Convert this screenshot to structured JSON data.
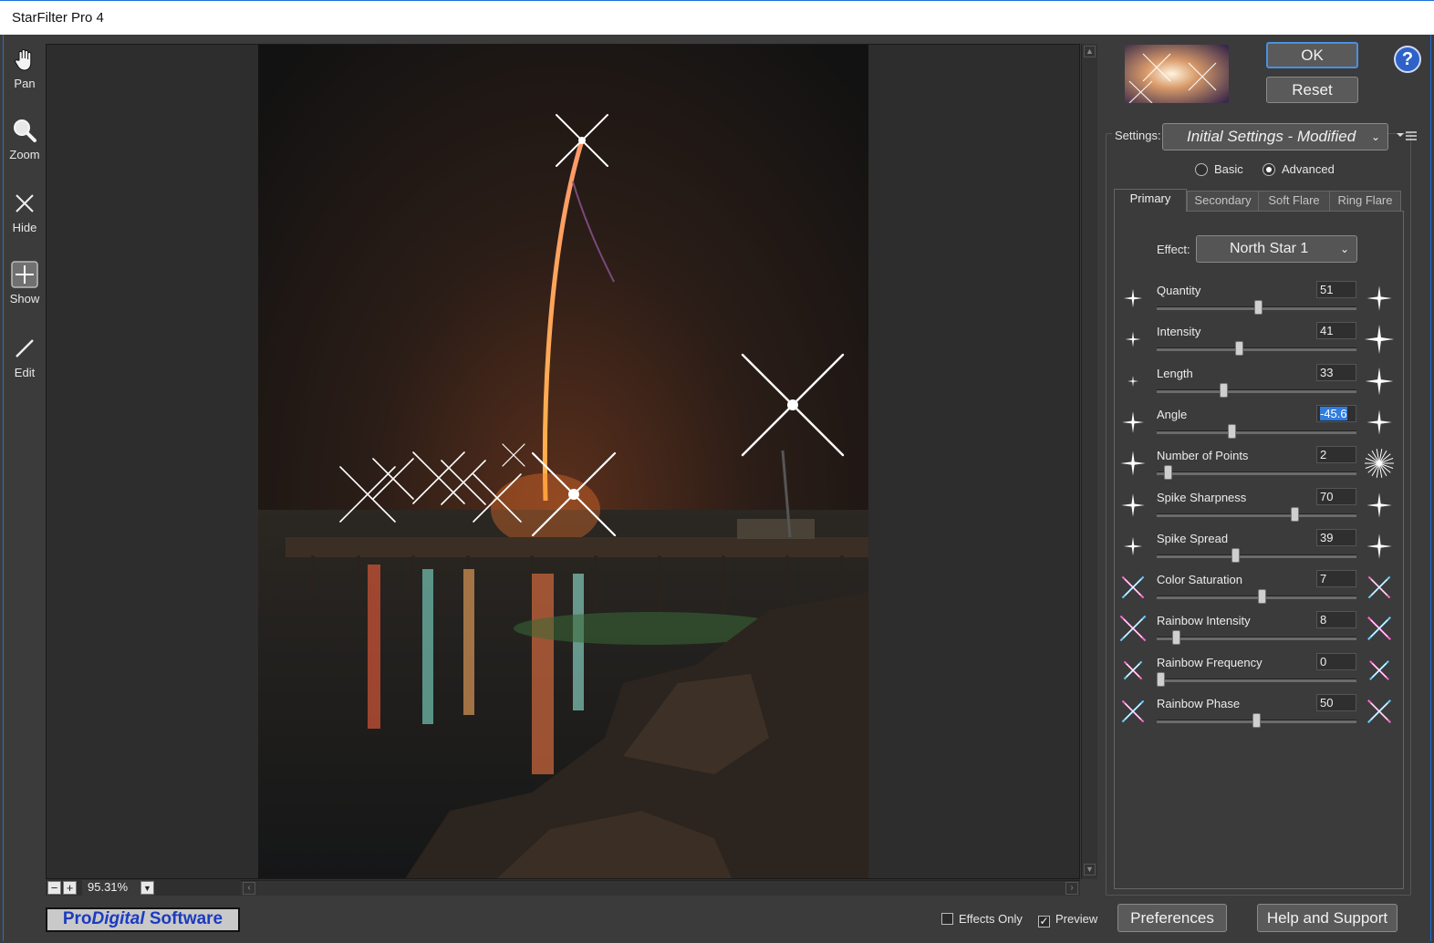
{
  "window": {
    "title": "StarFilter Pro 4"
  },
  "tools": [
    {
      "label": "Pan",
      "icon": "hand-icon"
    },
    {
      "label": "Zoom",
      "icon": "magnifier-icon"
    },
    {
      "label": "Hide",
      "icon": "x-icon"
    },
    {
      "label": "Show",
      "icon": "plus-box-icon"
    },
    {
      "label": "Edit",
      "icon": "pencil-icon"
    }
  ],
  "preview": {
    "zoom": "95.31%"
  },
  "logo": {
    "pro": "Pro",
    "digital": "Digital",
    "software": " Software"
  },
  "footer": {
    "effects_only": "Effects Only",
    "effects_only_checked": false,
    "preview_label": "Preview",
    "preview_checked": true,
    "preferences": "Preferences",
    "help_support": "Help and Support"
  },
  "buttons": {
    "ok": "OK",
    "reset": "Reset",
    "help": "?"
  },
  "settings": {
    "label": "Settings:",
    "value": "Initial Settings - Modified",
    "mode_basic": "Basic",
    "mode_advanced": "Advanced",
    "mode_selected": "Advanced"
  },
  "tabs": [
    {
      "label": "Primary",
      "active": true
    },
    {
      "label": "Secondary",
      "active": false
    },
    {
      "label": "Soft Flare",
      "active": false
    },
    {
      "label": "Ring Flare",
      "active": false
    }
  ],
  "effect": {
    "label": "Effect:",
    "value": "North Star 1"
  },
  "sliders": [
    {
      "name": "Quantity",
      "value": "51",
      "fraction": 0.51
    },
    {
      "name": "Intensity",
      "value": "41",
      "fraction": 0.41
    },
    {
      "name": "Length",
      "value": "33",
      "fraction": 0.33
    },
    {
      "name": "Angle",
      "value": "-45.6",
      "fraction": 0.37,
      "selected": true
    },
    {
      "name": "Number of Points",
      "value": "2",
      "fraction": 0.04
    },
    {
      "name": "Spike Sharpness",
      "value": "70",
      "fraction": 0.7
    },
    {
      "name": "Spike Spread",
      "value": "39",
      "fraction": 0.39
    },
    {
      "name": "Color Saturation",
      "value": "7",
      "fraction": 0.53
    },
    {
      "name": "Rainbow Intensity",
      "value": "8",
      "fraction": 0.08
    },
    {
      "name": "Rainbow Frequency",
      "value": "0",
      "fraction": 0.0
    },
    {
      "name": "Rainbow Phase",
      "value": "50",
      "fraction": 0.5
    }
  ]
}
